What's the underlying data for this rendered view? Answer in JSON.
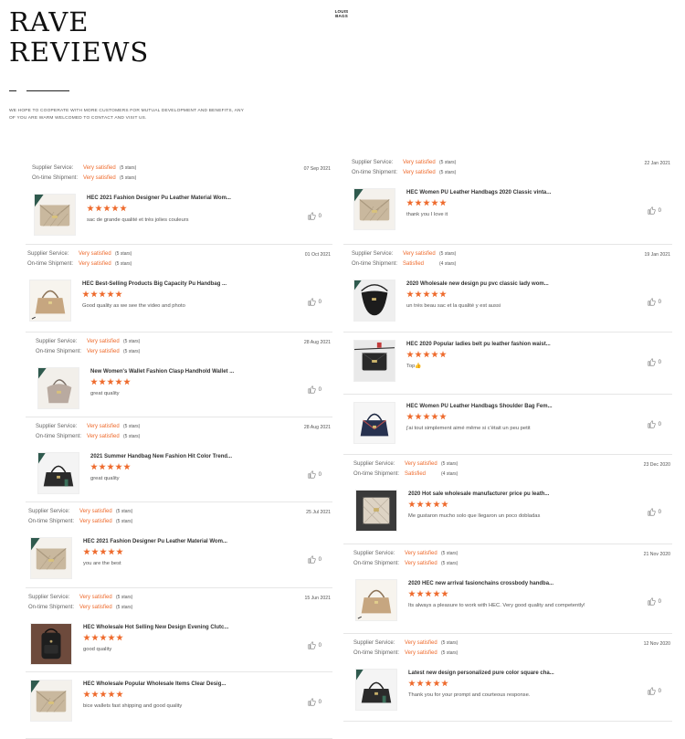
{
  "page_title_line1": "RAVE",
  "page_title_line2": "REVIEWS",
  "logo_line1": "LOUIS",
  "logo_line2": "BAGS",
  "intro_text": "WE HOPE TO COOPERATE WITH MORE CUSTOMERS FOR MUTUAL DEVELOPMENT AND BENEFITS, ANY OF YOU ARE WARM WELCOMED TO CONTACT AND VISIT US.",
  "labels": {
    "supplier_service": "Supplier Service:",
    "ontime_shipment": "On-time Shipment:"
  },
  "colors": {
    "accent": "#ee6a2c",
    "divider": "#e6e6e6"
  },
  "rating_stars": 5,
  "like_icon": "thumbs-up-icon",
  "reviews": [
    {
      "date": "07 Sep 2021",
      "service": "Very satisfied",
      "service_stars": "(5 stars)",
      "shipment": "Very satisfied",
      "shipment_stars": "(5 stars)",
      "product": "HEC 2021 Fashion Designer Pu Leather Material Wom...",
      "comment": "sac de grande qualité et très jolies couleurs",
      "likes": "0",
      "thumb": "beige-quilted-bag"
    },
    {
      "date": "01 Oct 2021",
      "service": "Very satisfied",
      "service_stars": "(5 stars)",
      "shipment": "Very satisfied",
      "shipment_stars": "(5 stars)",
      "product": "HEC Best-Selling Products Big Capacity Pu Handbag ...",
      "comment": "Good quality as we see the video and photo",
      "likes": "0",
      "thumb": "tan-tote-bag"
    },
    {
      "date": "28 Aug 2021",
      "service": "Very satisfied",
      "service_stars": "(5 stars)",
      "shipment": "Very satisfied",
      "shipment_stars": "(5 stars)",
      "product": "New Women's Wallet Fashion Clasp Handhold Wallet ...",
      "comment": "great quality",
      "likes": "0",
      "thumb": "taupe-hobo-bag"
    },
    {
      "date": "28 Aug 2021",
      "service": "Very satisfied",
      "service_stars": "(5 stars)",
      "shipment": "Very satisfied",
      "shipment_stars": "(5 stars)",
      "product": "2021 Summer Handbag New Fashion Hit Color Trend...",
      "comment": "great quality",
      "likes": "0",
      "thumb": "black-tote-bag"
    },
    {
      "date": "25 Jul 2021",
      "service": "Very satisfied",
      "service_stars": "(5 stars)",
      "shipment": "Very satisfied",
      "shipment_stars": "(5 stars)",
      "product": "HEC 2021 Fashion Designer Pu Leather Material Wom...",
      "comment": "you are the best",
      "likes": "0",
      "thumb": "beige-quilted-bag"
    },
    {
      "date": "15 Jun 2021",
      "service": "Very satisfied",
      "service_stars": "(5 stars)",
      "shipment": "Very satisfied",
      "shipment_stars": "(5 stars)",
      "product": "HEC Wholesale Hot Selling New Design Evening Clutc...",
      "comment": "good quality",
      "likes": "0",
      "thumb": "black-backpack"
    },
    {
      "date": "",
      "service": "",
      "service_stars": "",
      "shipment": "",
      "shipment_stars": "",
      "product": "HEC Wholesale Popular Wholesale Items Clear Desig...",
      "comment": "bice wallets fast shipping and good quality",
      "likes": "0",
      "thumb": "beige-quilted-bag"
    },
    {
      "date": "22 Jan 2021",
      "service": "Very satisfied",
      "service_stars": "(5 stars)",
      "shipment": "Very satisfied",
      "shipment_stars": "(5 stars)",
      "product": "HEC Women PU Leather Handbags 2020 Classic vinta...",
      "comment": "thank you I love it",
      "likes": "0",
      "thumb": "beige-quilted-bag"
    },
    {
      "date": "19 Jan 2021",
      "service": "Very satisfied",
      "service_stars": "(5 stars)",
      "shipment": "Satisfied",
      "shipment_stars": "(4 stars)",
      "product": "2020 Wholesale new design pu pvc classic lady wom...",
      "comment": "un très beau sac et la qualité y est aussi",
      "likes": "0",
      "thumb": "black-hobo-bag"
    },
    {
      "date": "",
      "service": "",
      "service_stars": "",
      "shipment": "",
      "shipment_stars": "",
      "product": "HEC 2020 Popular ladies belt pu leather fashion waist...",
      "comment": "Top👍",
      "likes": "0",
      "thumb": "black-belt-bag"
    },
    {
      "date": "",
      "service": "",
      "service_stars": "",
      "shipment": "",
      "shipment_stars": "",
      "product": "HEC Women PU Leather Handbags Shoulder Bag Fem...",
      "comment": "j'ai tout simplement aimé même si c'était un peu petit",
      "likes": "0",
      "thumb": "navy-handbag"
    },
    {
      "date": "23 Dec 2020",
      "service": "Very satisfied",
      "service_stars": "(5 stars)",
      "shipment": "Satisfied",
      "shipment_stars": "(4 stars)",
      "product": "2020 Hot sale wholesale manufacturer price pu leath...",
      "comment": "Me gustaron mucho solo que llegaron un poco dobladas",
      "likes": "0",
      "thumb": "cream-quilted-bag"
    },
    {
      "date": "21 Nov 2020",
      "service": "Very satisfied",
      "service_stars": "(5 stars)",
      "shipment": "Very satisfied",
      "shipment_stars": "(5 stars)",
      "product": "2020 HEC new arrival fasionchains crossbody handba...",
      "comment": "Its always a pleasure to work with HEC. Very good quality and competently!",
      "likes": "0",
      "thumb": "tan-tote-bag"
    },
    {
      "date": "12 Nov 2020",
      "service": "Very satisfied",
      "service_stars": "(5 stars)",
      "shipment": "Very satisfied",
      "shipment_stars": "(5 stars)",
      "product": "Latest new design personalized pure color square cha...",
      "comment": "Thank you for your prompt and courteous response.",
      "likes": "0",
      "thumb": "black-tote-bag"
    }
  ]
}
